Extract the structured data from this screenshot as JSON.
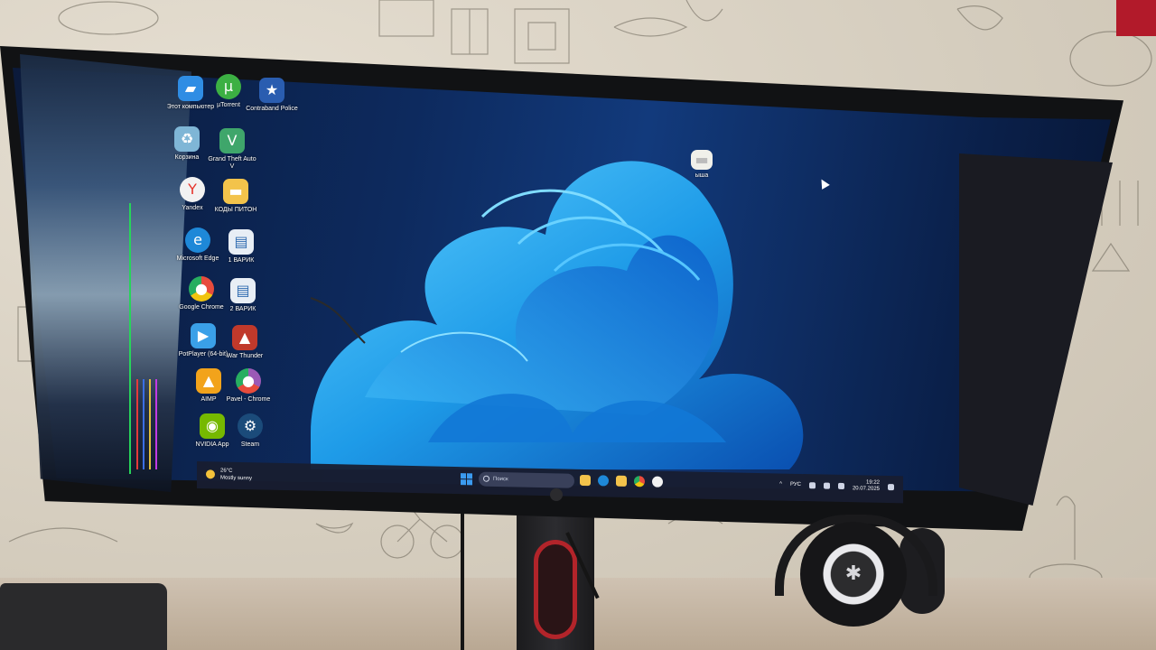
{
  "desktop": {
    "icons": [
      {
        "id": "this-pc",
        "label": "Этот компьютер",
        "icon": "monitor-icon",
        "color": "#2f8de4"
      },
      {
        "id": "utorrent",
        "label": "µTorrent",
        "icon": "utorrent-icon",
        "color": "#3cb043"
      },
      {
        "id": "contraband-police",
        "label": "Contraband Police",
        "icon": "contraband-police-icon",
        "color": "#2a5db0"
      },
      {
        "id": "recycle-bin",
        "label": "Корзина",
        "icon": "recycle-bin-icon",
        "color": "#7fb6d6"
      },
      {
        "id": "gta-v",
        "label": "Grand Theft Auto V",
        "icon": "gta-icon",
        "color": "#3fa66b"
      },
      {
        "id": "yandex",
        "label": "Yandex",
        "icon": "yandex-icon",
        "color": "#f2f2f2"
      },
      {
        "id": "kody-piton",
        "label": "КОДЫ ПИТОН",
        "icon": "folder-icon",
        "color": "#f3c34b"
      },
      {
        "id": "ms-edge",
        "label": "Microsoft Edge",
        "icon": "edge-icon",
        "color": "#1e88d8"
      },
      {
        "id": "variant-1",
        "label": "1 ВАРИК",
        "icon": "python-file-icon",
        "color": "#e8eef5"
      },
      {
        "id": "chrome",
        "label": "Google Chrome",
        "icon": "chrome-icon",
        "color": "#e74c3c"
      },
      {
        "id": "variant-2",
        "label": "2 ВАРИК",
        "icon": "python-file-icon",
        "color": "#e8eef5"
      },
      {
        "id": "pot-player",
        "label": "PotPlayer (64-bit)",
        "icon": "play-icon",
        "color": "#3aa0e8"
      },
      {
        "id": "war-thunder",
        "label": "War Thunder",
        "icon": "war-thunder-icon",
        "color": "#c0392b"
      },
      {
        "id": "aimp",
        "label": "AIMP",
        "icon": "aimp-icon",
        "color": "#f2a31b"
      },
      {
        "id": "pavel-chrome",
        "label": "Pavel - Chrome",
        "icon": "chrome-profile-icon",
        "color": "#9b59b6"
      },
      {
        "id": "nvidia-app",
        "label": "NVIDIA App",
        "icon": "nvidia-icon",
        "color": "#76b900"
      },
      {
        "id": "steam",
        "label": "Steam",
        "icon": "steam-icon",
        "color": "#1b4b7a"
      },
      {
        "id": "folder-top",
        "label": "ыша",
        "icon": "folder-icon",
        "color": "#f0f0ea"
      }
    ]
  },
  "taskbar": {
    "weather_temp": "26°C",
    "weather_desc": "Mostly sunny",
    "search_placeholder": "Поиск",
    "language": "РУС",
    "time": "19:22",
    "date": "20.07.2025",
    "apps": [
      {
        "name": "file-explorer-icon",
        "color": "#f3c34b"
      },
      {
        "name": "edge-icon",
        "color": "#1e88d8"
      },
      {
        "name": "folder-icon",
        "color": "#f3c34b"
      },
      {
        "name": "chrome-icon",
        "color": "#e74c3c"
      },
      {
        "name": "yandex-icon",
        "color": "#f2f2f2"
      }
    ]
  },
  "colors": {
    "wallpaper_bloom": "#2fa7ee",
    "screen_bg": "#0d2a5e",
    "accent": "#3b9bf0"
  }
}
